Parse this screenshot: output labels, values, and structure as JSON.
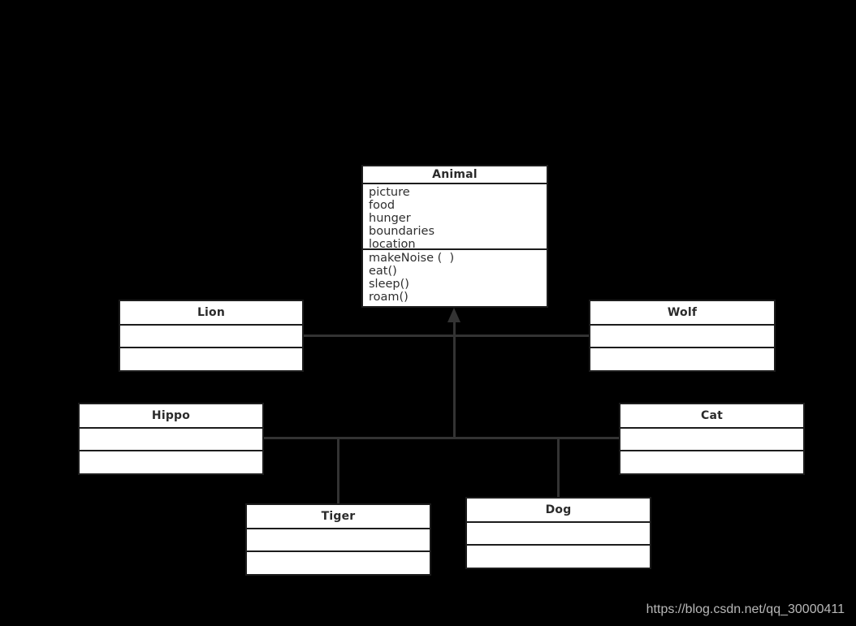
{
  "diagram": {
    "type": "uml-class-diagram",
    "background_color": "#000000",
    "box_fill_color": "#ffffff",
    "box_border_color": "#1c1c1c",
    "connector_color": "#333333",
    "relationship": "generalization",
    "classes": {
      "animal": {
        "name": "Animal",
        "attributes": [
          "picture",
          "food",
          "hunger",
          "boundaries",
          "location"
        ],
        "operations": [
          "makeNoise (  )",
          "eat()",
          "sleep()",
          "roam()"
        ]
      },
      "lion": {
        "name": "Lion",
        "attributes": [],
        "operations": []
      },
      "wolf": {
        "name": "Wolf",
        "attributes": [],
        "operations": []
      },
      "hippo": {
        "name": "Hippo",
        "attributes": [],
        "operations": []
      },
      "cat": {
        "name": "Cat",
        "attributes": [],
        "operations": []
      },
      "tiger": {
        "name": "Tiger",
        "attributes": [],
        "operations": []
      },
      "dog": {
        "name": "Dog",
        "attributes": [],
        "operations": []
      }
    }
  },
  "watermark": {
    "text": "https://blog.csdn.net/qq_30000411"
  }
}
